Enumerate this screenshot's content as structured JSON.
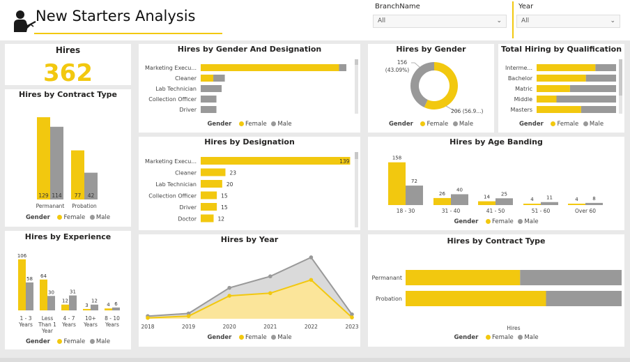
{
  "header": {
    "title": "New Starters Analysis"
  },
  "slicers": {
    "branch": {
      "label": "BranchName",
      "value": "All"
    },
    "year": {
      "label": "Year",
      "value": "All"
    }
  },
  "colors": {
    "female": "#F2C80F",
    "male": "#999999",
    "background": "#e9e9e9"
  },
  "legend": {
    "title": "Gender",
    "female": "Female",
    "male": "Male"
  },
  "kpi": {
    "title": "Hires",
    "value": "362"
  },
  "chart_data": [
    {
      "id": "contract_type_col",
      "type": "bar",
      "title": "Hires by Contract Type",
      "categories": [
        "Permanant",
        "Probation"
      ],
      "series": [
        {
          "name": "Female",
          "values": [
            129,
            77
          ]
        },
        {
          "name": "Male",
          "values": [
            114,
            42
          ]
        }
      ],
      "ylim": [
        0,
        140
      ],
      "legend": "bottom"
    },
    {
      "id": "gender_designation",
      "type": "bar",
      "orientation": "horizontal",
      "stacked": true,
      "title": "Hires by Gender And Designation",
      "categories": [
        "Marketing Execu...",
        "Cleaner",
        "Lab Technician",
        "Collection Officer",
        "Driver"
      ],
      "series": [
        {
          "name": "Female",
          "values": [
            132,
            12,
            0,
            0,
            0
          ]
        },
        {
          "name": "Male",
          "values": [
            7,
            11,
            20,
            15,
            15
          ]
        }
      ],
      "xlim": [
        0,
        145
      ],
      "legend": "bottom"
    },
    {
      "id": "designation",
      "type": "bar",
      "orientation": "horizontal",
      "title": "Hires by Designation",
      "categories": [
        "Marketing Execu...",
        "Cleaner",
        "Lab Technician",
        "Collection Officer",
        "Driver",
        "Doctor"
      ],
      "values": [
        139,
        23,
        20,
        15,
        15,
        12
      ],
      "xlim": [
        0,
        140
      ]
    },
    {
      "id": "gender_donut",
      "type": "pie",
      "donut": true,
      "title": "Hires by Gender",
      "labels": [
        "Female",
        "Male"
      ],
      "values": [
        206,
        156
      ],
      "data_labels": [
        "206 (56.9...)",
        "156",
        "(43.09%)"
      ],
      "legend": "bottom"
    },
    {
      "id": "qualification",
      "type": "bar",
      "orientation": "horizontal",
      "stacked": true,
      "percent": true,
      "title": "Total Hiring by Qualification",
      "categories": [
        "Interme...",
        "Bachelor",
        "Matric",
        "Middle",
        "Masters"
      ],
      "series": [
        {
          "name": "Female",
          "values": [
            0.74,
            0.62,
            0.42,
            0.25,
            0.56
          ]
        },
        {
          "name": "Male",
          "values": [
            0.26,
            0.38,
            0.58,
            0.75,
            0.44
          ]
        }
      ],
      "legend": "bottom"
    },
    {
      "id": "age_banding",
      "type": "bar",
      "title": "Hires by Age Banding",
      "categories": [
        "18 - 30",
        "31 - 40",
        "41 - 50",
        "51 - 60",
        "Over 60"
      ],
      "series": [
        {
          "name": "Female",
          "values": [
            158,
            26,
            14,
            4,
            4
          ]
        },
        {
          "name": "Male",
          "values": [
            72,
            40,
            25,
            11,
            8
          ]
        }
      ],
      "ylim": [
        0,
        165
      ],
      "legend": "bottom"
    },
    {
      "id": "experience",
      "type": "bar",
      "title": "Hires by Experience",
      "categories": [
        [
          "1 - 3",
          "Years"
        ],
        [
          "Less",
          "Than 1",
          "Year"
        ],
        [
          "4 - 7",
          "Years"
        ],
        [
          "10+",
          "Years"
        ],
        [
          "8 - 10",
          "Years"
        ]
      ],
      "series": [
        {
          "name": "Female",
          "values": [
            106,
            64,
            12,
            3,
            4
          ]
        },
        {
          "name": "Male",
          "values": [
            58,
            30,
            31,
            12,
            6
          ]
        }
      ],
      "ylim": [
        0,
        110
      ],
      "legend": "bottom"
    },
    {
      "id": "by_year",
      "type": "area",
      "stacked": true,
      "title": "Hires by Year",
      "x": [
        "2018",
        "2019",
        "2020",
        "2021",
        "2022",
        "2023"
      ],
      "series": [
        {
          "name": "Female",
          "values": [
            2,
            6,
            52,
            58,
            88,
            3
          ]
        },
        {
          "name": "Male",
          "values": [
            4,
            6,
            18,
            38,
            51,
            7
          ]
        }
      ],
      "ylim": [
        0,
        150
      ],
      "legend": "bottom"
    },
    {
      "id": "contract_type_100",
      "type": "bar",
      "orientation": "horizontal",
      "stacked": true,
      "percent": true,
      "title": "Hires by Contract Type",
      "categories": [
        "Permanant",
        "Probation"
      ],
      "series": [
        {
          "name": "Female",
          "values": [
            0.53,
            0.65
          ]
        },
        {
          "name": "Male",
          "values": [
            0.47,
            0.35
          ]
        }
      ],
      "xlabel": "Hires",
      "legend": "bottom"
    }
  ]
}
